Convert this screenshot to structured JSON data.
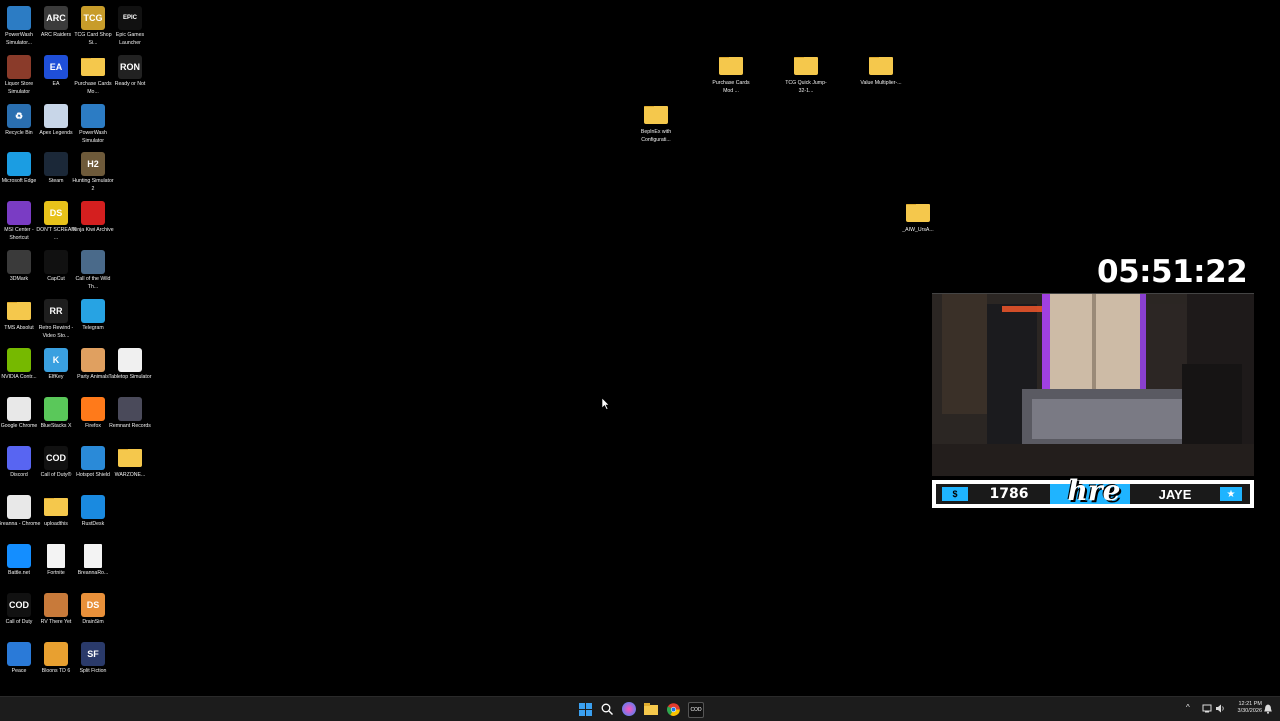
{
  "desktop": {
    "icons": [
      {
        "label": "PowerWash Simulator...",
        "glyph": "",
        "color": "#2c7cc4",
        "icon": "powerwash-icon"
      },
      {
        "label": "ARC Raiders",
        "glyph": "ARC",
        "color": "#3b3b3b",
        "icon": "arc-raiders-icon"
      },
      {
        "label": "TCG Card Shop Si...",
        "glyph": "TCG",
        "color": "#c89c2a",
        "icon": "tcg-card-shop-icon"
      },
      {
        "label": "Epic Games Launcher",
        "glyph": "EPIC",
        "color": "#111111",
        "icon": "epic-games-icon"
      },
      {
        "label": "Liquor Store Simulator",
        "glyph": "",
        "color": "#8a3b2a",
        "icon": "liquor-store-icon"
      },
      {
        "label": "EA",
        "glyph": "EA",
        "color": "#1f4fd8",
        "icon": "ea-icon"
      },
      {
        "label": "Purchase Cards Mo...",
        "glyph": "",
        "color": "",
        "icon": "folder-icon"
      },
      {
        "label": "Ready or Not",
        "glyph": "RON",
        "color": "#222222",
        "icon": "ready-or-not-icon"
      },
      {
        "label": "Recycle Bin",
        "glyph": "♻",
        "color": "#2a6fb0",
        "icon": "recycle-bin-icon"
      },
      {
        "label": "Apex Legends",
        "glyph": "",
        "color": "#c8d6e8",
        "icon": "apex-legends-icon"
      },
      {
        "label": "PowerWash Simulator",
        "glyph": "",
        "color": "#2c7cc4",
        "icon": "powerwash-icon"
      },
      {
        "label": "Microsoft Edge",
        "glyph": "",
        "color": "#1b9de2",
        "icon": "edge-icon"
      },
      {
        "label": "Steam",
        "glyph": "",
        "color": "#1b2838",
        "icon": "steam-icon"
      },
      {
        "label": "Hunting Simulator 2",
        "glyph": "H2",
        "color": "#6e5a3a",
        "icon": "hunting-sim-icon"
      },
      {
        "label": "MSI Center - Shortcut",
        "glyph": "",
        "color": "#7a3cc4",
        "icon": "msi-center-icon"
      },
      {
        "label": "DON'T SCREAM ...",
        "glyph": "DS",
        "color": "#e8c21a",
        "icon": "dont-scream-icon"
      },
      {
        "label": "Ninja Kiwi Archive",
        "glyph": "",
        "color": "#d41f1f",
        "icon": "ninja-kiwi-icon"
      },
      {
        "label": "3DMark",
        "glyph": "",
        "color": "#3a3a3a",
        "icon": "3dmark-icon"
      },
      {
        "label": "CapCut",
        "glyph": "",
        "color": "#111111",
        "icon": "capcut-icon"
      },
      {
        "label": "Call of the Wild Th...",
        "glyph": "",
        "color": "#4a6a8a",
        "icon": "call-of-the-wild-icon"
      },
      {
        "label": "TMS Absolut",
        "glyph": "",
        "color": "",
        "icon": "folder-icon"
      },
      {
        "label": "Retro Rewind - Video Sto...",
        "glyph": "RR",
        "color": "#1e1e1e",
        "icon": "retro-rewind-icon"
      },
      {
        "label": "Telegram",
        "glyph": "",
        "color": "#27a3e3",
        "icon": "telegram-icon"
      },
      {
        "label": "NVIDIA Contr...",
        "glyph": "",
        "color": "#76b900",
        "icon": "nvidia-icon"
      },
      {
        "label": "ElfKey",
        "glyph": "K",
        "color": "#3aa0e0",
        "icon": "elfkey-icon"
      },
      {
        "label": "Party Animals",
        "glyph": "",
        "color": "#e0a060",
        "icon": "party-animals-icon"
      },
      {
        "label": "Tabletop Simulator",
        "glyph": "",
        "color": "#f0f0f0",
        "icon": "tabletop-sim-icon"
      },
      {
        "label": "Google Chrome",
        "glyph": "",
        "color": "#e8e8e8",
        "icon": "chrome-icon"
      },
      {
        "label": "BlueStacks X",
        "glyph": "",
        "color": "#5ac85a",
        "icon": "bluestacks-icon"
      },
      {
        "label": "Firefox",
        "glyph": "",
        "color": "#ff7a1a",
        "icon": "firefox-icon"
      },
      {
        "label": "Remnant Records",
        "glyph": "",
        "color": "#4a4a5a",
        "icon": "remnant-records-icon"
      },
      {
        "label": "Discord",
        "glyph": "",
        "color": "#5865f2",
        "icon": "discord-icon"
      },
      {
        "label": "Call of Duty®",
        "glyph": "COD",
        "color": "#111111",
        "icon": "call-of-duty-icon"
      },
      {
        "label": "Hotspot Shield",
        "glyph": "",
        "color": "#2a8ad8",
        "icon": "hotspot-shield-icon"
      },
      {
        "label": "WARZONE...",
        "glyph": "",
        "color": "",
        "icon": "folder-icon"
      },
      {
        "label": "Breanna - Chrome",
        "glyph": "",
        "color": "#e8e8e8",
        "icon": "chrome-icon"
      },
      {
        "label": "uploadthis",
        "glyph": "",
        "color": "",
        "icon": "folder-icon"
      },
      {
        "label": "RustDesk",
        "glyph": "",
        "color": "#1a8ae0",
        "icon": "rustdesk-icon"
      },
      {
        "label": "Battle.net",
        "glyph": "",
        "color": "#148eff",
        "icon": "battlenet-icon"
      },
      {
        "label": "Fortnite",
        "glyph": "",
        "color": "",
        "icon": "document-icon"
      },
      {
        "label": "BreannaRo...",
        "glyph": "",
        "color": "",
        "icon": "document-icon"
      },
      {
        "label": "Call of Duty",
        "glyph": "COD",
        "color": "#111111",
        "icon": "call-of-duty-icon"
      },
      {
        "label": "RV There Yet",
        "glyph": "",
        "color": "#c87a3a",
        "icon": "rv-there-yet-icon"
      },
      {
        "label": "DrainSim",
        "glyph": "DS",
        "color": "#e8903a",
        "icon": "drainsim-icon"
      },
      {
        "label": "Peace",
        "glyph": "",
        "color": "#2a7ad8",
        "icon": "peace-icon"
      },
      {
        "label": "Bloons TD 6",
        "glyph": "",
        "color": "#e8a030",
        "icon": "bloons-td6-icon"
      },
      {
        "label": "Split Fiction",
        "glyph": "SF",
        "color": "#2a3a6a",
        "icon": "split-fiction-icon"
      }
    ],
    "folders": [
      {
        "label": "Purchase Cards Mod ..."
      },
      {
        "label": "TCG Quick Jump-32-1..."
      },
      {
        "label": "Value Multiplier-..."
      },
      {
        "label": "BepInEx with Configurati..."
      },
      {
        "label": "_AIW_UrsA..."
      }
    ]
  },
  "overlay": {
    "timer": "05:51:22",
    "counter": "1786",
    "counter_icon": "$",
    "name": "JAYE",
    "star": "★",
    "logo": "hre"
  },
  "taskbar": {
    "clock_time": "12:21 PM",
    "clock_date": "3/30/2026",
    "tray_chevron": "^"
  },
  "colors": {
    "accent_cyan": "#1fb4ff",
    "folder_yellow": "#f5c84c"
  }
}
